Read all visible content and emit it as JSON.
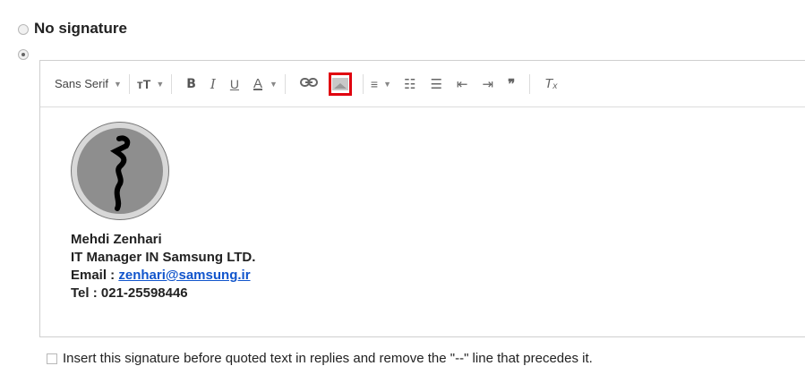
{
  "signature_options": {
    "no_signature_label": "No signature",
    "selected": "custom"
  },
  "toolbar": {
    "font_family": "Sans Serif",
    "font_size_icon": "text-size-icon",
    "bold": "B",
    "italic": "I",
    "underline": "U",
    "text_color": "A",
    "link_icon": "link-icon",
    "insert_image_icon": "insert-image-icon",
    "align_icon": "align-icon",
    "numbered_list_icon": "numbered-list-icon",
    "bulleted_list_icon": "bulleted-list-icon",
    "indent_less_icon": "indent-less-icon",
    "indent_more_icon": "indent-more-icon",
    "quote_icon": "quote-icon",
    "remove_format_icon": "remove-format-icon",
    "highlight_color": "#e0000f"
  },
  "signature": {
    "name": "Mehdi Zenhari",
    "title": "IT Manager IN Samsung LTD.",
    "email_label": "Email : ",
    "email": "zenhari@samsung.ir",
    "tel": "Tel : 021-25598446"
  },
  "footer": {
    "insert_before_quoted_label": "Insert this signature before quoted text in replies and remove the \"--\" line that precedes it."
  }
}
